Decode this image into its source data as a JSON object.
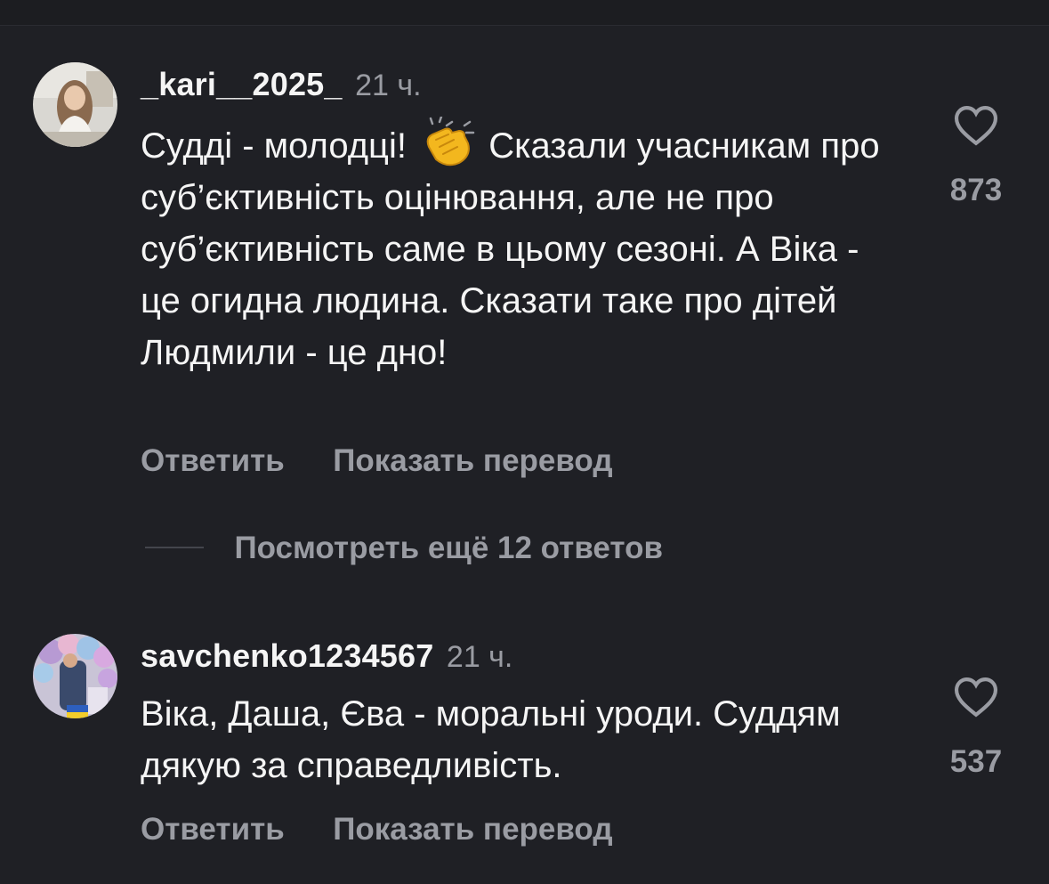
{
  "comments": [
    {
      "username": "_kari__2025_",
      "time": "21 ч.",
      "text_before": "Судді - молодці!",
      "emoji": "clapping-hands",
      "text_after": "Сказали учасникам про суб’єктивність оцінювання, але не про суб’єктивність саме в цьому сезоні. А Віка - це огидна людина. Сказати таке про дітей Людмили - це дно!",
      "likes": "873",
      "reply_label": "Ответить",
      "translate_label": "Показать перевод",
      "view_replies_label": "Посмотреть ещё 12 ответов"
    },
    {
      "username": "savchenko1234567",
      "time": "21 ч.",
      "text": "Віка, Даша, Єва - моральні уроди. Суддям дякую за справедливість.",
      "likes": "537",
      "reply_label": "Ответить",
      "translate_label": "Показать перевод"
    }
  ],
  "colors": {
    "background": "#1f2025",
    "primary_text": "#f5f5f5",
    "secondary_text": "#9a9ca3"
  }
}
